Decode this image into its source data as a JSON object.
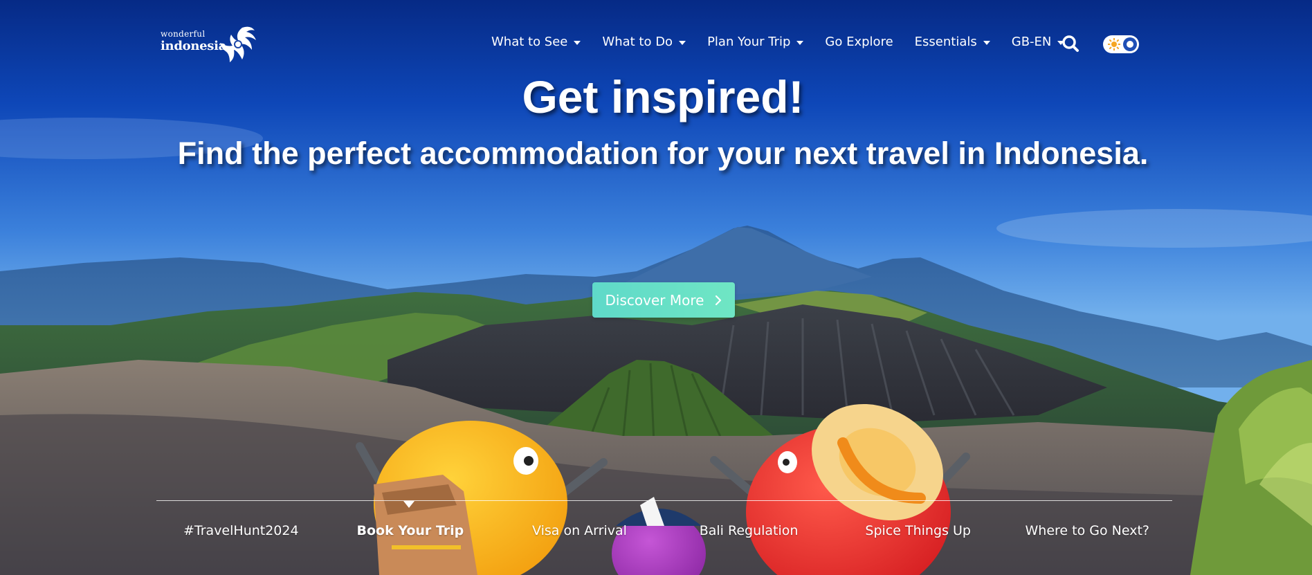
{
  "brand": {
    "logo_small": "wonderful",
    "logo_main": "indonesia"
  },
  "nav": {
    "items": [
      {
        "label": "What to See",
        "dropdown": true
      },
      {
        "label": "What to Do",
        "dropdown": true
      },
      {
        "label": "Plan Your Trip",
        "dropdown": true
      },
      {
        "label": "Go Explore",
        "dropdown": false
      },
      {
        "label": "Essentials",
        "dropdown": true
      },
      {
        "label": "GB-EN",
        "dropdown": true
      }
    ],
    "search_icon": "search-icon",
    "theme_toggle_icon": "sun-icon"
  },
  "hero": {
    "title": "Get inspired!",
    "subtitle": "Find the perfect accommodation for your next travel in Indonesia.",
    "cta_label": "Discover More",
    "cta_icon": "chevron-right-icon"
  },
  "tabs": [
    {
      "label": "#TravelHunt2024",
      "active": false
    },
    {
      "label": "Book Your Trip",
      "active": true
    },
    {
      "label": "Visa on Arrival",
      "active": false
    },
    {
      "label": "Bali Regulation",
      "active": false
    },
    {
      "label": "Spice Things Up",
      "active": false
    },
    {
      "label": "Where to Go Next?",
      "active": false
    }
  ],
  "colors": {
    "sky_top": "#0a2c8c",
    "sky_bottom": "#5ea1e6",
    "cta": "#63dcc6",
    "toggle_knob": "#1f4fb6"
  }
}
